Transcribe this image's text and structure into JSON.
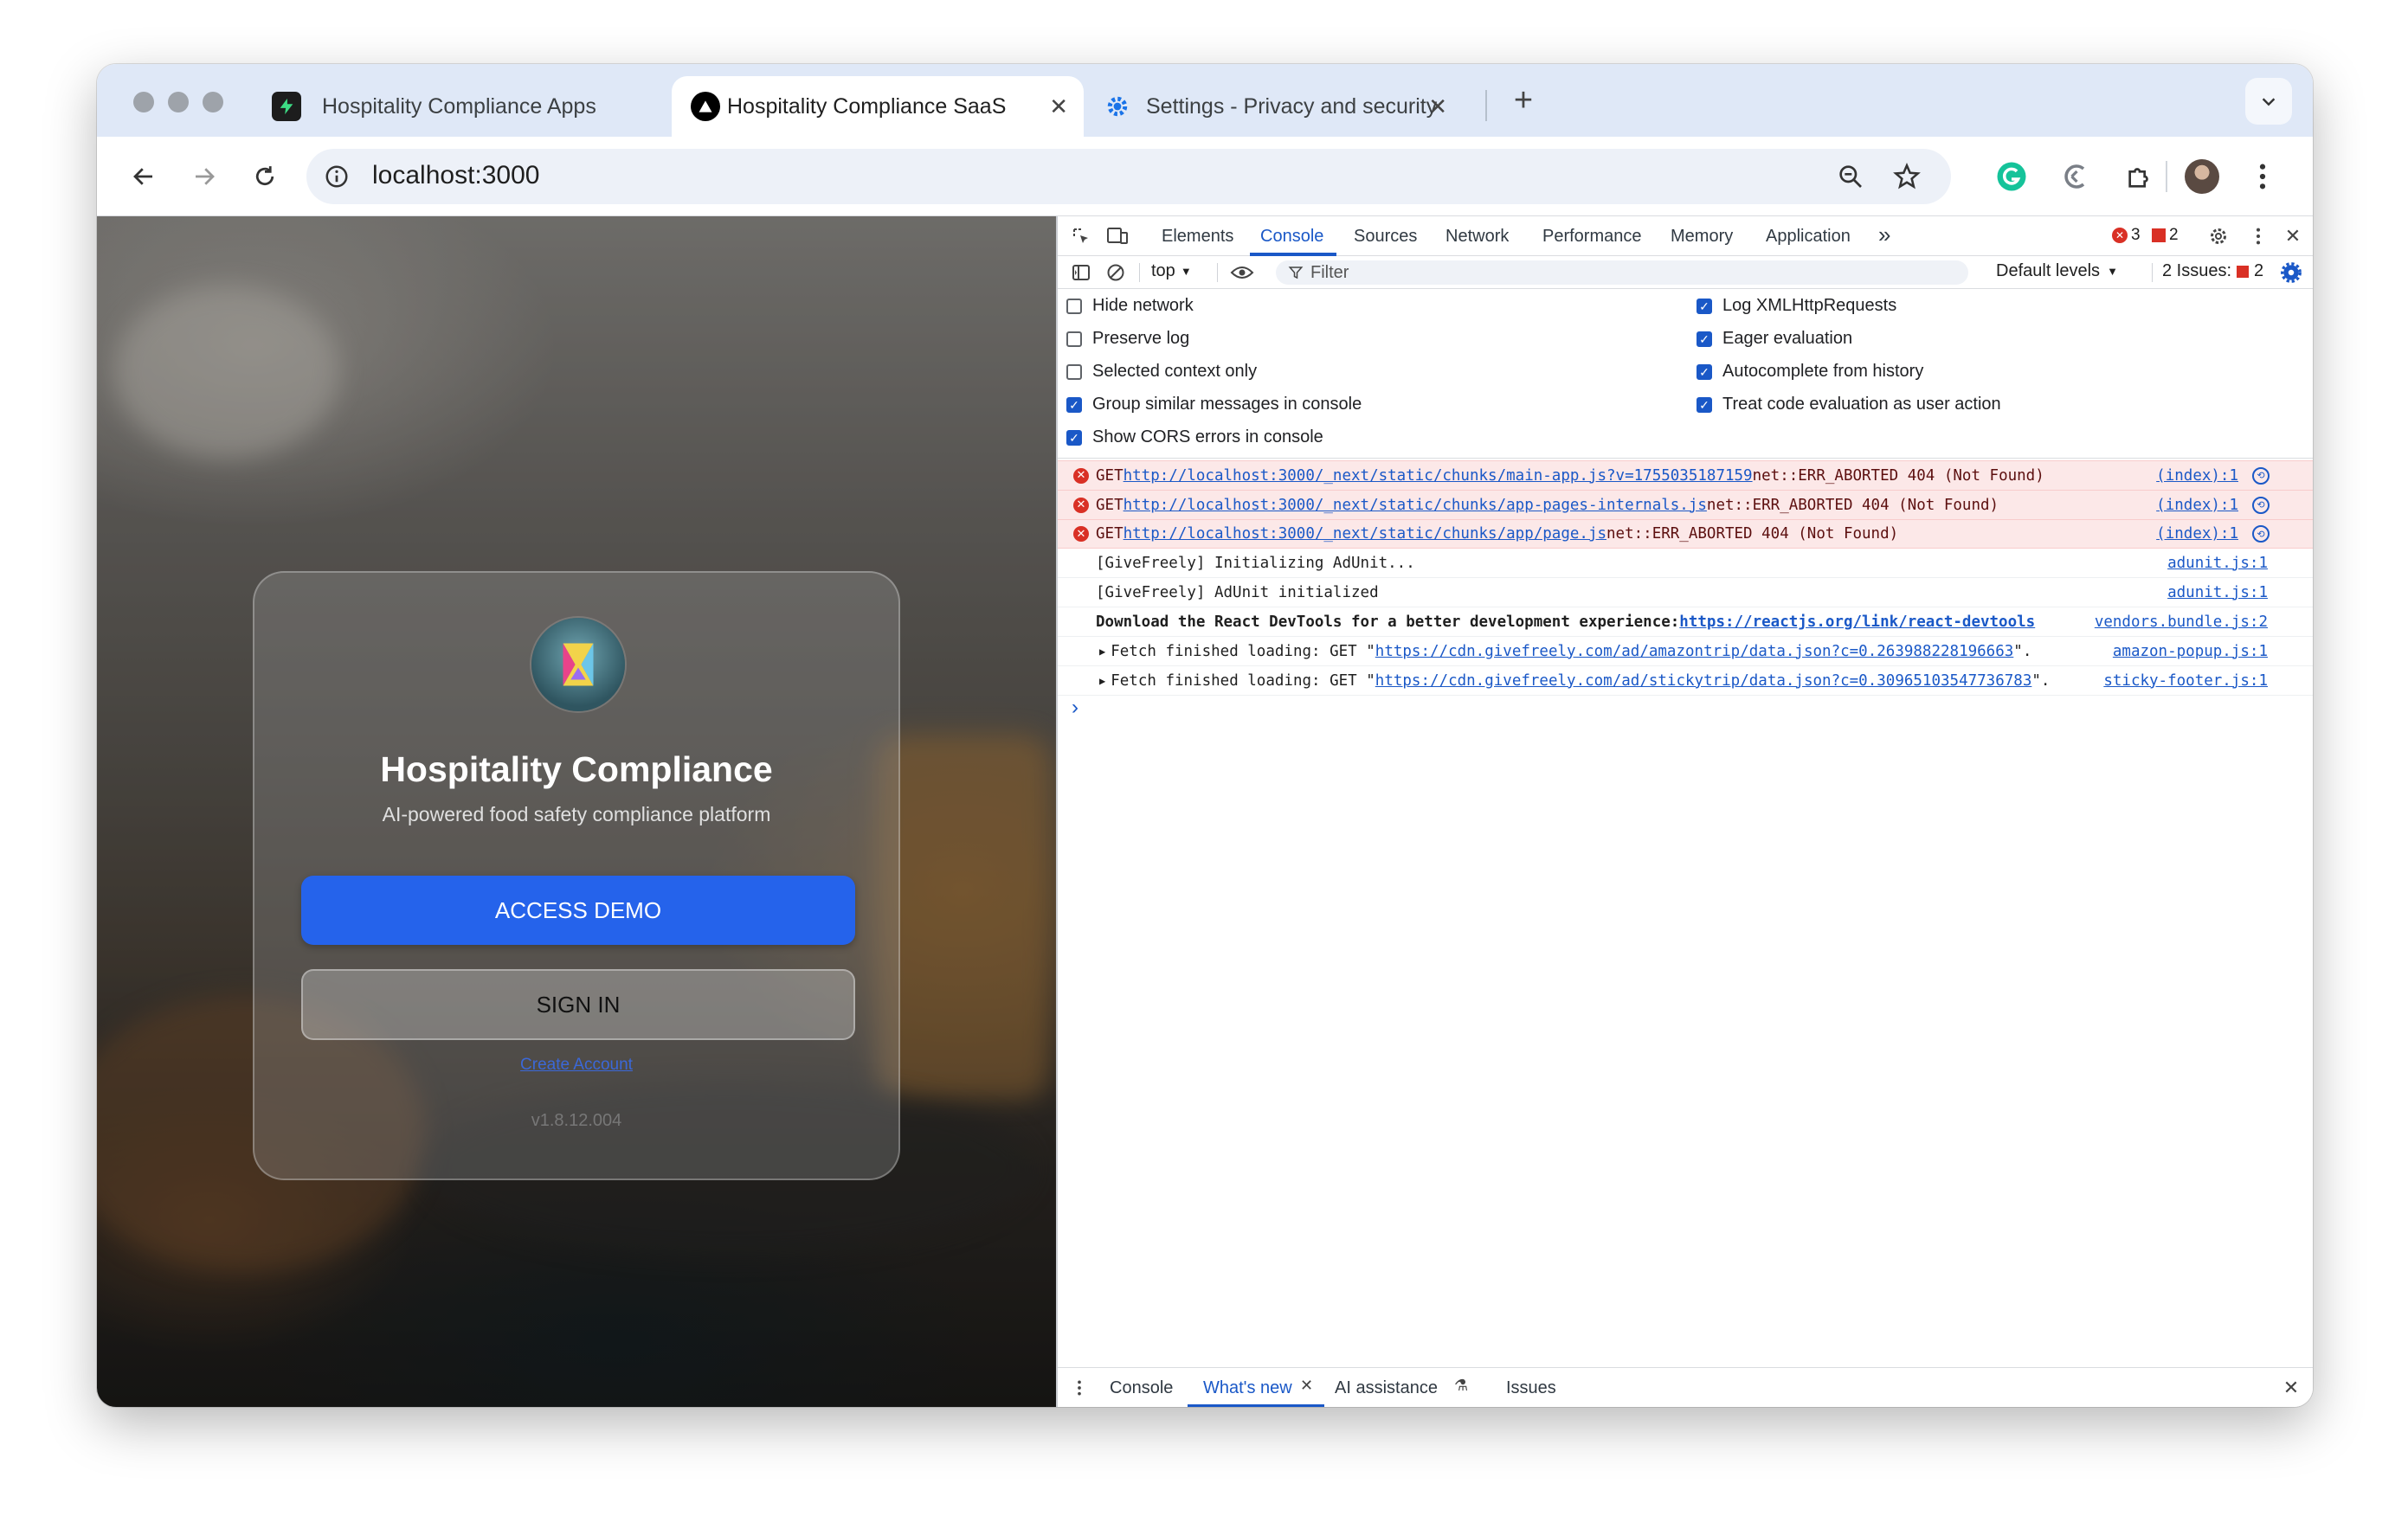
{
  "browser": {
    "tabs": [
      {
        "title": "Hospitality Compliance Apps",
        "favicon": "bolt-favicon",
        "color": "#1d1d1d"
      },
      {
        "title": "Hospitality Compliance SaaS",
        "favicon": "triangle-favicon",
        "color": "#000000"
      },
      {
        "title": "Settings - Privacy and security",
        "favicon": "gear-favicon",
        "color": "#1a73e8"
      }
    ],
    "active_tab_index": 1,
    "url": "localhost:3000",
    "new_tab_symbol": "+",
    "tab_search_icon": "chevron-down-icon"
  },
  "page": {
    "title": "Hospitality Compliance",
    "subtitle": "AI-powered food safety compliance platform",
    "access_demo_label": "ACCESS DEMO",
    "sign_in_label": "SIGN IN",
    "create_account_label": "Create Account",
    "version": "v1.8.12.004",
    "accent_color": "#2563eb"
  },
  "devtools": {
    "tabs": [
      "Elements",
      "Console",
      "Sources",
      "Network",
      "Performance",
      "Memory",
      "Application"
    ],
    "active_tab": "Console",
    "more_tabs_symbol": "»",
    "error_count": "3",
    "warning_count": "2",
    "context": "top",
    "filter_placeholder": "Filter",
    "default_levels": "Default levels",
    "issues_label": "2 Issues:",
    "issues_count": "2",
    "settings": {
      "left": [
        {
          "label": "Hide network",
          "checked": false
        },
        {
          "label": "Preserve log",
          "checked": false
        },
        {
          "label": "Selected context only",
          "checked": false
        },
        {
          "label": "Group similar messages in console",
          "checked": true
        },
        {
          "label": "Show CORS errors in console",
          "checked": true
        }
      ],
      "right": [
        {
          "label": "Log XMLHttpRequests",
          "checked": true
        },
        {
          "label": "Eager evaluation",
          "checked": true
        },
        {
          "label": "Autocomplete from history",
          "checked": true
        },
        {
          "label": "Treat code evaluation as user action",
          "checked": true
        }
      ]
    },
    "messages": [
      {
        "level": "error",
        "prefix": "GET ",
        "link": "http://localhost:3000/_next/static/chunks/main-app.js?v=1755035187159",
        "suffix": " net::ERR_ABORTED 404 (Not Found)",
        "source": "(index):1"
      },
      {
        "level": "error",
        "prefix": "GET ",
        "link": "http://localhost:3000/_next/static/chunks/app-pages-internals.js",
        "suffix": " net::ERR_ABORTED 404 (Not Found)",
        "source": "(index):1"
      },
      {
        "level": "error",
        "prefix": "GET ",
        "link": "http://localhost:3000/_next/static/chunks/app/page.js",
        "suffix": " net::ERR_ABORTED 404 (Not Found)",
        "source": "(index):1"
      },
      {
        "level": "log",
        "prefix": "[GiveFreely] Initializing AdUnit...",
        "link": "",
        "suffix": "",
        "source": "adunit.js:1"
      },
      {
        "level": "log",
        "prefix": "[GiveFreely] AdUnit initialized",
        "link": "",
        "suffix": "",
        "source": "adunit.js:1"
      },
      {
        "level": "log-bold",
        "prefix": "Download the React DevTools for a better development experience: ",
        "link": "https://reactjs.org/link/react-devtools",
        "suffix": "",
        "source": "vendors.bundle.js:2"
      },
      {
        "level": "fetch",
        "prefix": "Fetch finished loading: GET \"",
        "link": "https://cdn.givefreely.com/ad/amazontrip/data.json?c=0.263988228196663",
        "suffix": "\".",
        "source": "amazon-popup.js:1"
      },
      {
        "level": "fetch",
        "prefix": "Fetch finished loading: GET \"",
        "link": "https://cdn.givefreely.com/ad/stickytrip/data.json?c=0.30965103547736783",
        "suffix": "\".",
        "source": "sticky-footer.js:1"
      }
    ],
    "prompt_symbol": "›",
    "drawer_tabs": [
      "Console",
      "What's new",
      "AI assistance",
      "Issues"
    ],
    "drawer_active": "What's new"
  }
}
